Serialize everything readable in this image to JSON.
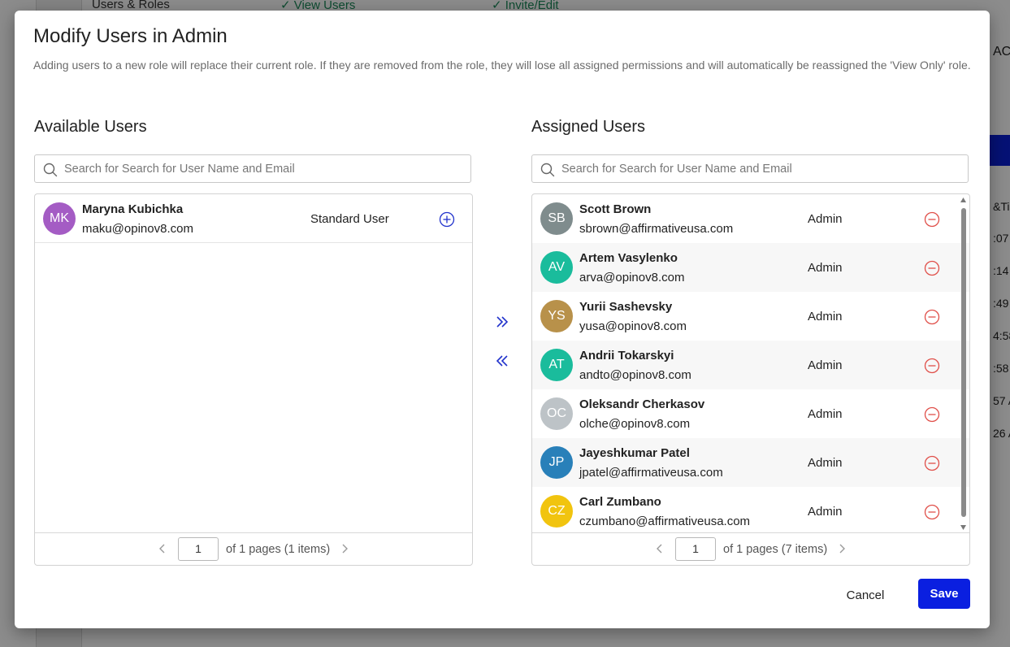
{
  "background": {
    "top_items": [
      "Users & Roles",
      "✓ View Users",
      "✓ Invite/Edit"
    ],
    "right_fragments": [
      "AC",
      "&Ti",
      ":07",
      ":14",
      ":49",
      "4:58",
      ":58",
      "57 A",
      "26 A"
    ]
  },
  "modal": {
    "title": "Modify Users in Admin",
    "description": "Adding users to a new role will replace their current role. If they are removed from the role, they will lose all assigned permissions and will automatically be reassigned the 'View Only' role.",
    "cancel_label": "Cancel",
    "save_label": "Save"
  },
  "available": {
    "title": "Available Users",
    "search_placeholder": "Search for Search for User Name and Email",
    "users": [
      {
        "initials": "MK",
        "name": "Maryna Kubichka",
        "email": "maku@opinov8.com",
        "role": "Standard User",
        "color": "#a45cc4"
      }
    ],
    "pager": {
      "page": "1",
      "summary": "of 1 pages (1 items)"
    }
  },
  "assigned": {
    "title": "Assigned Users",
    "search_placeholder": "Search for Search for User Name and Email",
    "users": [
      {
        "initials": "SB",
        "name": "Scott Brown",
        "email": "sbrown@affirmativeusa.com",
        "role": "Admin",
        "color": "#7f8c8d"
      },
      {
        "initials": "AV",
        "name": "Artem Vasylenko",
        "email": "arva@opinov8.com",
        "role": "Admin",
        "color": "#1abc9c"
      },
      {
        "initials": "YS",
        "name": "Yurii Sashevsky",
        "email": "yusa@opinov8.com",
        "role": "Admin",
        "color": "#b8914a"
      },
      {
        "initials": "AT",
        "name": "Andrii Tokarskyi",
        "email": "andto@opinov8.com",
        "role": "Admin",
        "color": "#1abc9c"
      },
      {
        "initials": "OC",
        "name": "Oleksandr Cherkasov",
        "email": "olche@opinov8.com",
        "role": "Admin",
        "color": "#bdc3c7"
      },
      {
        "initials": "JP",
        "name": "Jayeshkumar Patel",
        "email": "jpatel@affirmativeusa.com",
        "role": "Admin",
        "color": "#2980b9"
      },
      {
        "initials": "CZ",
        "name": "Carl Zumbano",
        "email": "czumbano@affirmativeusa.com",
        "role": "Admin",
        "color": "#f1c40f"
      }
    ],
    "pager": {
      "page": "1",
      "summary": "of 1 pages (7 items)"
    }
  },
  "colors": {
    "accent": "#0a1fe0",
    "add_icon": "#2233cc",
    "remove_icon": "#e0504a"
  },
  "icons": {
    "move_right": "double-chevron-right-icon",
    "move_left": "double-chevron-left-icon",
    "add": "plus-circle-icon",
    "remove": "minus-circle-icon",
    "search": "search-icon"
  }
}
